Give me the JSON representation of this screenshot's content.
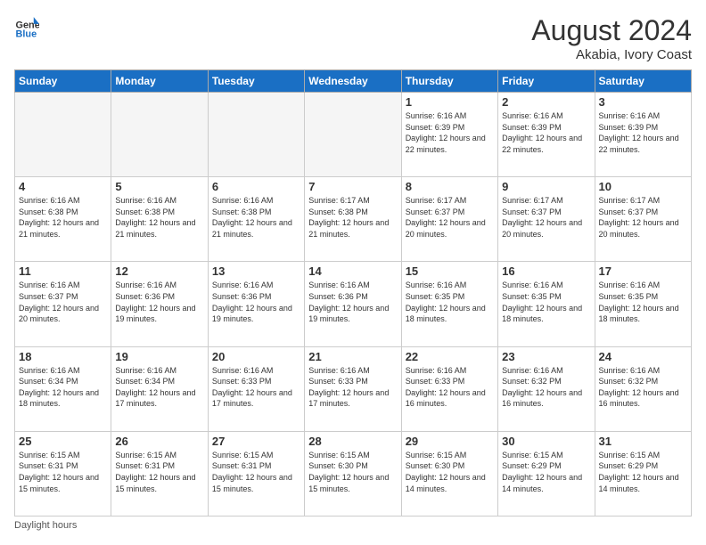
{
  "header": {
    "logo_general": "General",
    "logo_blue": "Blue",
    "month_year": "August 2024",
    "location": "Akabia, Ivory Coast"
  },
  "days_of_week": [
    "Sunday",
    "Monday",
    "Tuesday",
    "Wednesday",
    "Thursday",
    "Friday",
    "Saturday"
  ],
  "weeks": [
    [
      {
        "day": "",
        "empty": true
      },
      {
        "day": "",
        "empty": true
      },
      {
        "day": "",
        "empty": true
      },
      {
        "day": "",
        "empty": true
      },
      {
        "day": "1",
        "sunrise": "6:16 AM",
        "sunset": "6:39 PM",
        "daylight": "12 hours and 22 minutes."
      },
      {
        "day": "2",
        "sunrise": "6:16 AM",
        "sunset": "6:39 PM",
        "daylight": "12 hours and 22 minutes."
      },
      {
        "day": "3",
        "sunrise": "6:16 AM",
        "sunset": "6:39 PM",
        "daylight": "12 hours and 22 minutes."
      }
    ],
    [
      {
        "day": "4",
        "sunrise": "6:16 AM",
        "sunset": "6:38 PM",
        "daylight": "12 hours and 21 minutes."
      },
      {
        "day": "5",
        "sunrise": "6:16 AM",
        "sunset": "6:38 PM",
        "daylight": "12 hours and 21 minutes."
      },
      {
        "day": "6",
        "sunrise": "6:16 AM",
        "sunset": "6:38 PM",
        "daylight": "12 hours and 21 minutes."
      },
      {
        "day": "7",
        "sunrise": "6:17 AM",
        "sunset": "6:38 PM",
        "daylight": "12 hours and 21 minutes."
      },
      {
        "day": "8",
        "sunrise": "6:17 AM",
        "sunset": "6:37 PM",
        "daylight": "12 hours and 20 minutes."
      },
      {
        "day": "9",
        "sunrise": "6:17 AM",
        "sunset": "6:37 PM",
        "daylight": "12 hours and 20 minutes."
      },
      {
        "day": "10",
        "sunrise": "6:17 AM",
        "sunset": "6:37 PM",
        "daylight": "12 hours and 20 minutes."
      }
    ],
    [
      {
        "day": "11",
        "sunrise": "6:16 AM",
        "sunset": "6:37 PM",
        "daylight": "12 hours and 20 minutes."
      },
      {
        "day": "12",
        "sunrise": "6:16 AM",
        "sunset": "6:36 PM",
        "daylight": "12 hours and 19 minutes."
      },
      {
        "day": "13",
        "sunrise": "6:16 AM",
        "sunset": "6:36 PM",
        "daylight": "12 hours and 19 minutes."
      },
      {
        "day": "14",
        "sunrise": "6:16 AM",
        "sunset": "6:36 PM",
        "daylight": "12 hours and 19 minutes."
      },
      {
        "day": "15",
        "sunrise": "6:16 AM",
        "sunset": "6:35 PM",
        "daylight": "12 hours and 18 minutes."
      },
      {
        "day": "16",
        "sunrise": "6:16 AM",
        "sunset": "6:35 PM",
        "daylight": "12 hours and 18 minutes."
      },
      {
        "day": "17",
        "sunrise": "6:16 AM",
        "sunset": "6:35 PM",
        "daylight": "12 hours and 18 minutes."
      }
    ],
    [
      {
        "day": "18",
        "sunrise": "6:16 AM",
        "sunset": "6:34 PM",
        "daylight": "12 hours and 18 minutes."
      },
      {
        "day": "19",
        "sunrise": "6:16 AM",
        "sunset": "6:34 PM",
        "daylight": "12 hours and 17 minutes."
      },
      {
        "day": "20",
        "sunrise": "6:16 AM",
        "sunset": "6:33 PM",
        "daylight": "12 hours and 17 minutes."
      },
      {
        "day": "21",
        "sunrise": "6:16 AM",
        "sunset": "6:33 PM",
        "daylight": "12 hours and 17 minutes."
      },
      {
        "day": "22",
        "sunrise": "6:16 AM",
        "sunset": "6:33 PM",
        "daylight": "12 hours and 16 minutes."
      },
      {
        "day": "23",
        "sunrise": "6:16 AM",
        "sunset": "6:32 PM",
        "daylight": "12 hours and 16 minutes."
      },
      {
        "day": "24",
        "sunrise": "6:16 AM",
        "sunset": "6:32 PM",
        "daylight": "12 hours and 16 minutes."
      }
    ],
    [
      {
        "day": "25",
        "sunrise": "6:15 AM",
        "sunset": "6:31 PM",
        "daylight": "12 hours and 15 minutes."
      },
      {
        "day": "26",
        "sunrise": "6:15 AM",
        "sunset": "6:31 PM",
        "daylight": "12 hours and 15 minutes."
      },
      {
        "day": "27",
        "sunrise": "6:15 AM",
        "sunset": "6:31 PM",
        "daylight": "12 hours and 15 minutes."
      },
      {
        "day": "28",
        "sunrise": "6:15 AM",
        "sunset": "6:30 PM",
        "daylight": "12 hours and 15 minutes."
      },
      {
        "day": "29",
        "sunrise": "6:15 AM",
        "sunset": "6:30 PM",
        "daylight": "12 hours and 14 minutes."
      },
      {
        "day": "30",
        "sunrise": "6:15 AM",
        "sunset": "6:29 PM",
        "daylight": "12 hours and 14 minutes."
      },
      {
        "day": "31",
        "sunrise": "6:15 AM",
        "sunset": "6:29 PM",
        "daylight": "12 hours and 14 minutes."
      }
    ]
  ],
  "footer": {
    "daylight_label": "Daylight hours"
  }
}
